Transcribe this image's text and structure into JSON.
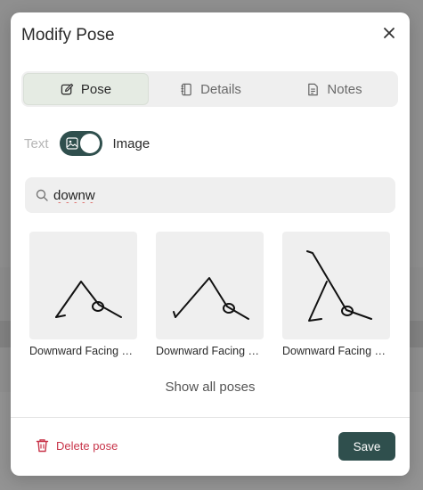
{
  "modal": {
    "title": "Modify Pose",
    "close_icon": "close-icon"
  },
  "tabs": [
    {
      "label": "Pose",
      "icon": "edit-icon",
      "active": true
    },
    {
      "label": "Details",
      "icon": "notebook-icon",
      "active": false
    },
    {
      "label": "Notes",
      "icon": "document-icon",
      "active": false
    }
  ],
  "mode": {
    "text_label": "Text",
    "image_label": "Image",
    "toggle_on": true
  },
  "search": {
    "value": "downw",
    "icon": "search-icon"
  },
  "results": [
    {
      "label": "Downward Facing Dog"
    },
    {
      "label": "Downward Facing Dog"
    },
    {
      "label": "Downward Facing Dog"
    }
  ],
  "show_all_label": "Show all poses",
  "footer": {
    "delete_label": "Delete pose",
    "save_label": "Save"
  },
  "colors": {
    "accent": "#2f4f4d",
    "danger": "#c8354a",
    "tab_active_bg": "#e5ebe3"
  }
}
